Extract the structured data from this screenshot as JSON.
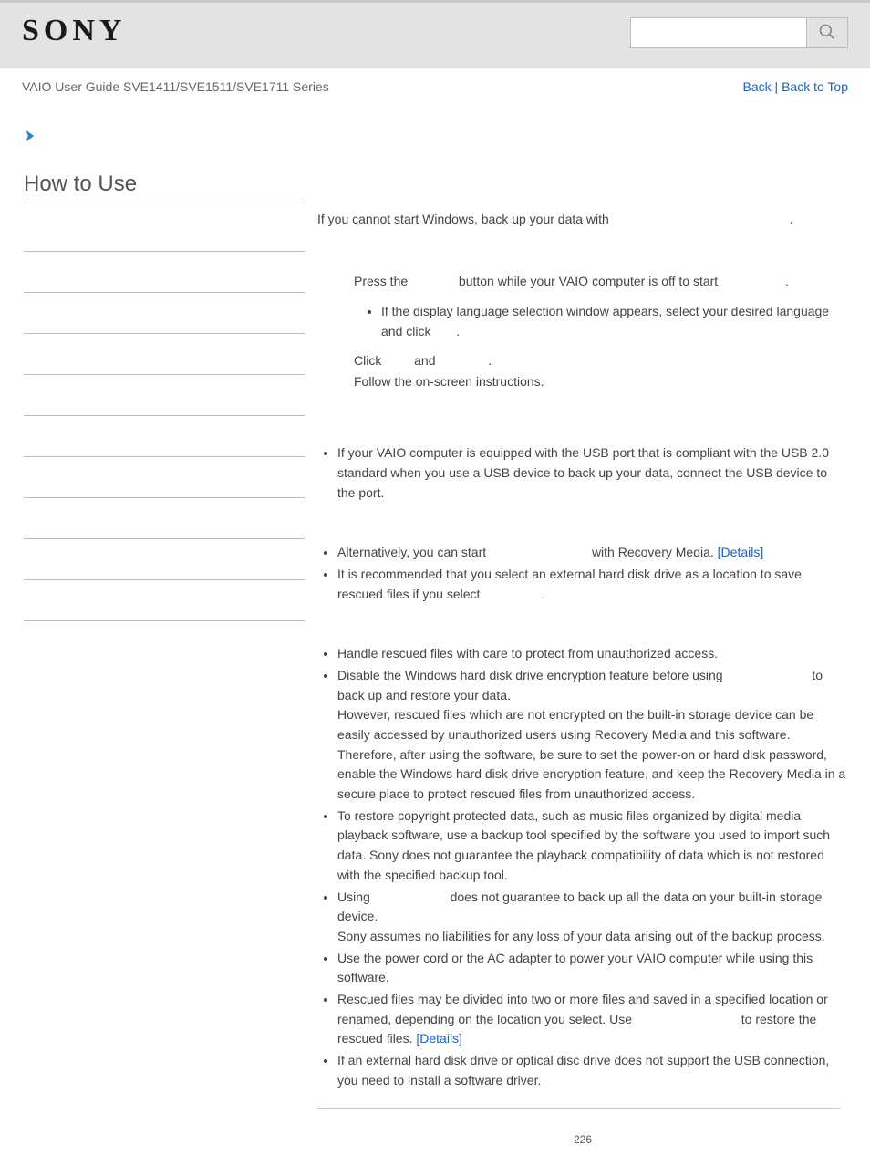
{
  "logo": "SONY",
  "guide_title": "VAIO User Guide SVE1411/SVE1511/SVE1711 Series",
  "search": {
    "placeholder": ""
  },
  "nav": {
    "back": "Back",
    "sep": " | ",
    "top": "Back to Top"
  },
  "sidebar": {
    "title": "How to Use"
  },
  "main": {
    "intro_1": "If you cannot start Windows, back up your data with ",
    "intro_2": ".",
    "step1_a": "Press the ",
    "step1_b": " button while your VAIO computer is off to start ",
    "step1_c": ".",
    "step1_sub_a": "If the display language selection window appears, select your desired language and click ",
    "step1_sub_b": ".",
    "step2_a": "Click ",
    "step2_b": " and ",
    "step2_c": ".",
    "step3": "Follow the on-screen instructions.",
    "hint1": "If your VAIO computer is equipped with the USB port that is compliant with the USB 2.0 standard when you use a USB device to back up your data, connect the USB device to the port.",
    "hint2_a": "Alternatively, you can start ",
    "hint2_b": " with Recovery Media. ",
    "details": "[Details]",
    "hint3_a": "It is recommended that you select an external hard disk drive as a location to save rescued files if you select ",
    "hint3_b": ".",
    "note1": "Handle rescued files with care to protect from unauthorized access.",
    "note2_a": "Disable the Windows hard disk drive encryption feature before using ",
    "note2_b": " to back up and restore your data.",
    "note2_c": "However, rescued files which are not encrypted on the built-in storage device can be easily accessed by unauthorized users using Recovery Media and this software. Therefore, after using the software, be sure to set the power-on or hard disk password, enable the Windows hard disk drive encryption feature, and keep the Recovery Media in a secure place to protect rescued files from unauthorized access.",
    "note3": "To restore copyright protected data, such as music files organized by digital media playback software, use a backup tool specified by the software you used to import such data. Sony does not guarantee the playback compatibility of data which is not restored with the specified backup tool.",
    "note4_a": "Using ",
    "note4_b": " does not guarantee to back up all the data on your built-in storage device.",
    "note4_c": "Sony assumes no liabilities for any loss of your data arising out of the backup process.",
    "note5": "Use the power cord or the AC adapter to power your VAIO computer while using this software.",
    "note6_a": "Rescued files may be divided into two or more files and saved in a specified location or renamed, depending on the location you select. Use ",
    "note6_b": " to restore the rescued files. ",
    "note7": "If an external hard disk drive or optical disc drive does not support the USB connection, you need to install a software driver."
  },
  "page_number": "226"
}
